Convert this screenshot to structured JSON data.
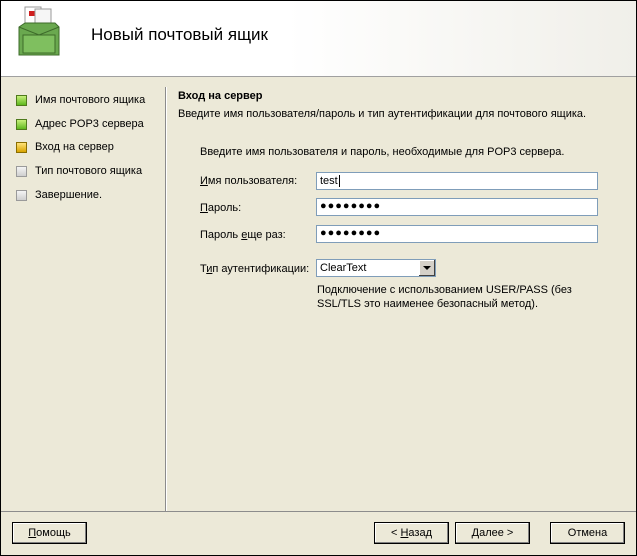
{
  "header": {
    "title": "Новый почтовый ящик",
    "icon": "mailbox-icon"
  },
  "steps": [
    {
      "label": "Имя почтового ящика",
      "state": "done"
    },
    {
      "label": "Адрес POP3 сервера",
      "state": "done"
    },
    {
      "label": "Вход на сервер",
      "state": "current"
    },
    {
      "label": "Тип почтового ящика",
      "state": "todo"
    },
    {
      "label": "Завершение.",
      "state": "todo"
    }
  ],
  "section": {
    "title": "Вход на сервер",
    "description": "Введите имя пользователя/пароль и тип аутентификации для почтового ящика."
  },
  "form": {
    "intro": "Введите имя пользователя и пароль, необходимые для POP3 сервера.",
    "username_label_key": "И",
    "username_label_rest": "мя пользователя:",
    "username_value": "test",
    "password_label_key": "П",
    "password_label_rest": "ароль:",
    "password_value": "●●●●●●●●",
    "password_again_label_pre": "Пароль ",
    "password_again_label_key": "е",
    "password_again_label_post": "ще раз:",
    "password_again_value": "●●●●●●●●",
    "auth_label_pre": "Т",
    "auth_label_key": "и",
    "auth_label_post": "п аутентификации:",
    "auth_value": "ClearText",
    "auth_note": "Подключение с использованием USER/PASS (без SSL/TLS это наименее безопасный метод)."
  },
  "buttons": {
    "help_key": "П",
    "help_rest": "омощь",
    "back_pre": "< ",
    "back_key": "Н",
    "back_rest": "азад",
    "next_key": "Д",
    "next_rest": "алее >",
    "cancel": "Отмена"
  },
  "colors": {
    "done": "#5fb81e",
    "current": "#d9a400",
    "todo": "#cfcfcf"
  }
}
